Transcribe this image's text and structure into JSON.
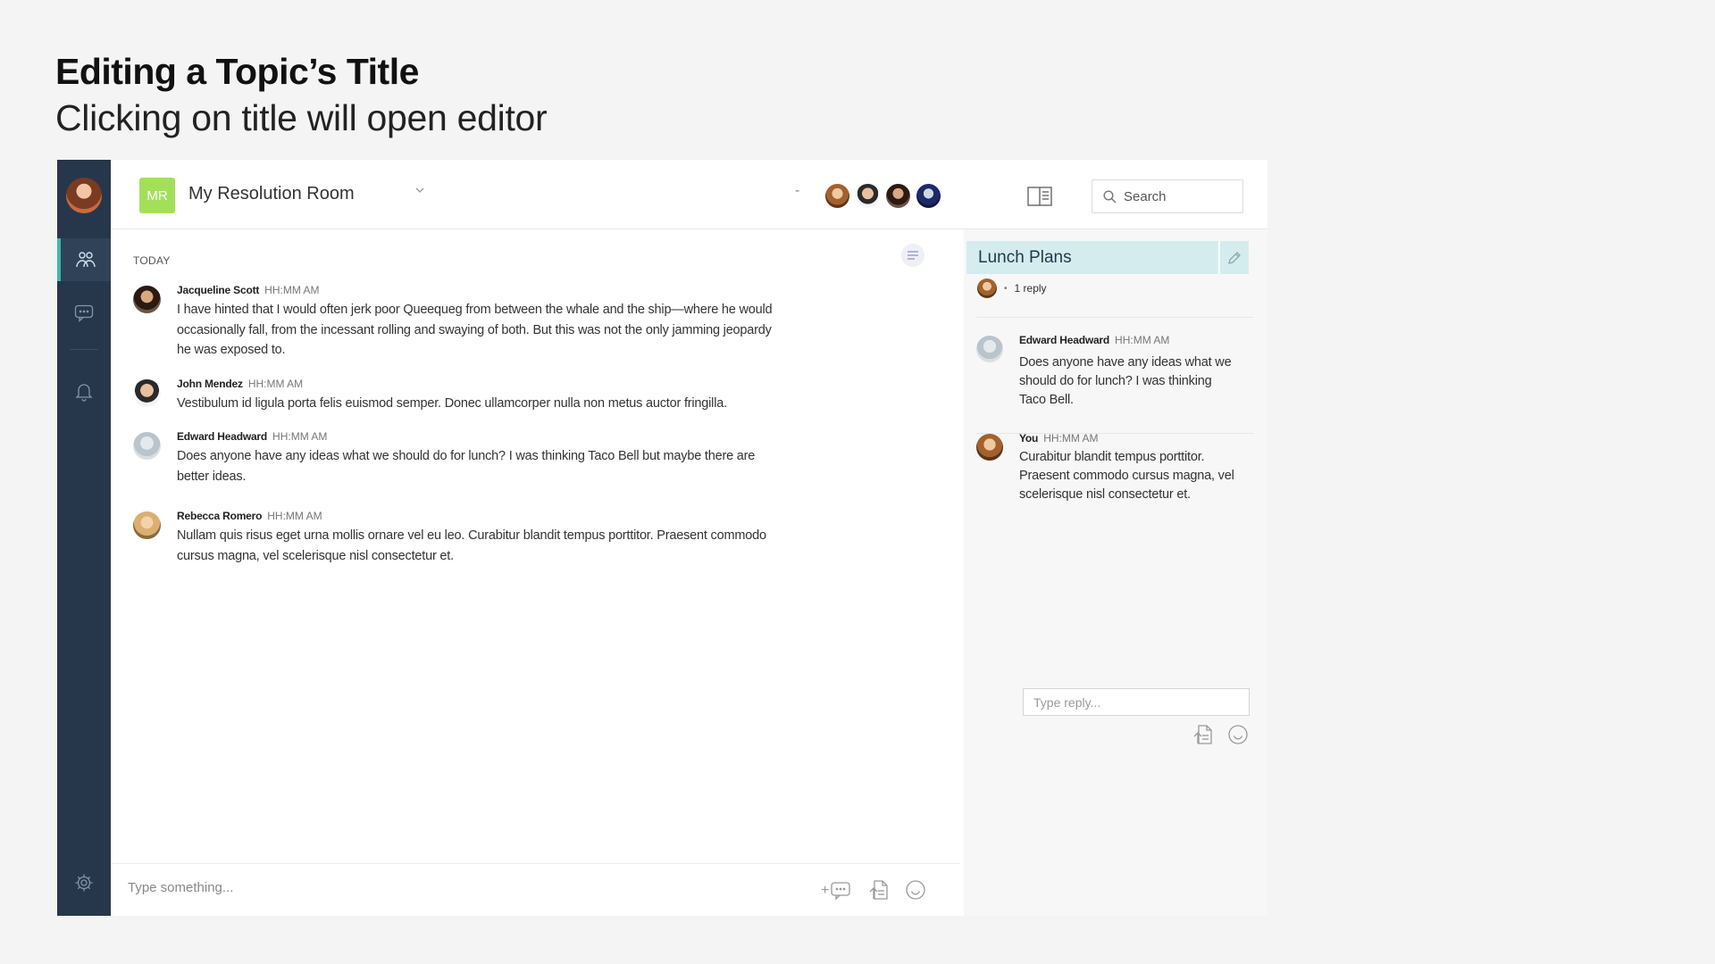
{
  "header": {
    "title": "Editing a Topic’s Title",
    "subtitle": "Clicking on title will open editor"
  },
  "sidebar": {
    "items": [
      {
        "icon": "people-icon",
        "active": true
      },
      {
        "icon": "chat-bubble-icon",
        "active": false
      },
      {
        "icon": "bell-icon",
        "active": false
      },
      {
        "icon": "gear-icon",
        "active": false
      }
    ]
  },
  "topbar": {
    "room_initials": "MR",
    "room_name": "My Resolution Room",
    "separator": "-",
    "search_placeholder": "Search",
    "accent_color": "#a3e05a"
  },
  "feed": {
    "day_label": "TODAY",
    "messages": [
      {
        "author": "Jacqueline Scott",
        "time": "HH:MM AM",
        "text": "I have hinted that I would often jerk poor Queequeg from between the whale and the ship—where he would occasionally fall, from the incessant rolling and swaying of both. But this was not the only jamming jeopardy he was exposed to."
      },
      {
        "author": "John Mendez",
        "time": "HH:MM AM",
        "text": "Vestibulum id ligula porta felis euismod semper. Donec ullamcorper nulla non metus auctor fringilla."
      },
      {
        "author": "Edward Headward",
        "time": "HH:MM AM",
        "text": "Does anyone have any ideas what we should do for lunch? I was thinking Taco Bell but maybe there are better ideas."
      },
      {
        "author": "Rebecca Romero",
        "time": "HH:MM AM",
        "text": "Nullam quis risus eget urna mollis ornare vel eu leo. Curabitur blandit tempus porttitor. Praesent commodo cursus magna, vel scelerisque nisl consectetur et."
      }
    ],
    "composer_placeholder": "Type something...",
    "add_topic_prefix": "+"
  },
  "thread": {
    "topic_title": "Lunch Plans",
    "topic_highlight_color": "#d5ecef",
    "reply_count": "1 reply",
    "bullet": "•",
    "replies": [
      {
        "author": "Edward Headward",
        "time": "HH:MM AM",
        "text": "Does anyone have any ideas what we should do for lunch? I was thinking Taco Bell."
      },
      {
        "author": "You",
        "time": "HH:MM AM",
        "text": "Curabitur blandit tempus porttitor. Praesent commodo cursus magna, vel scelerisque nisl consectetur et."
      }
    ],
    "reply_placeholder": "Type reply..."
  }
}
